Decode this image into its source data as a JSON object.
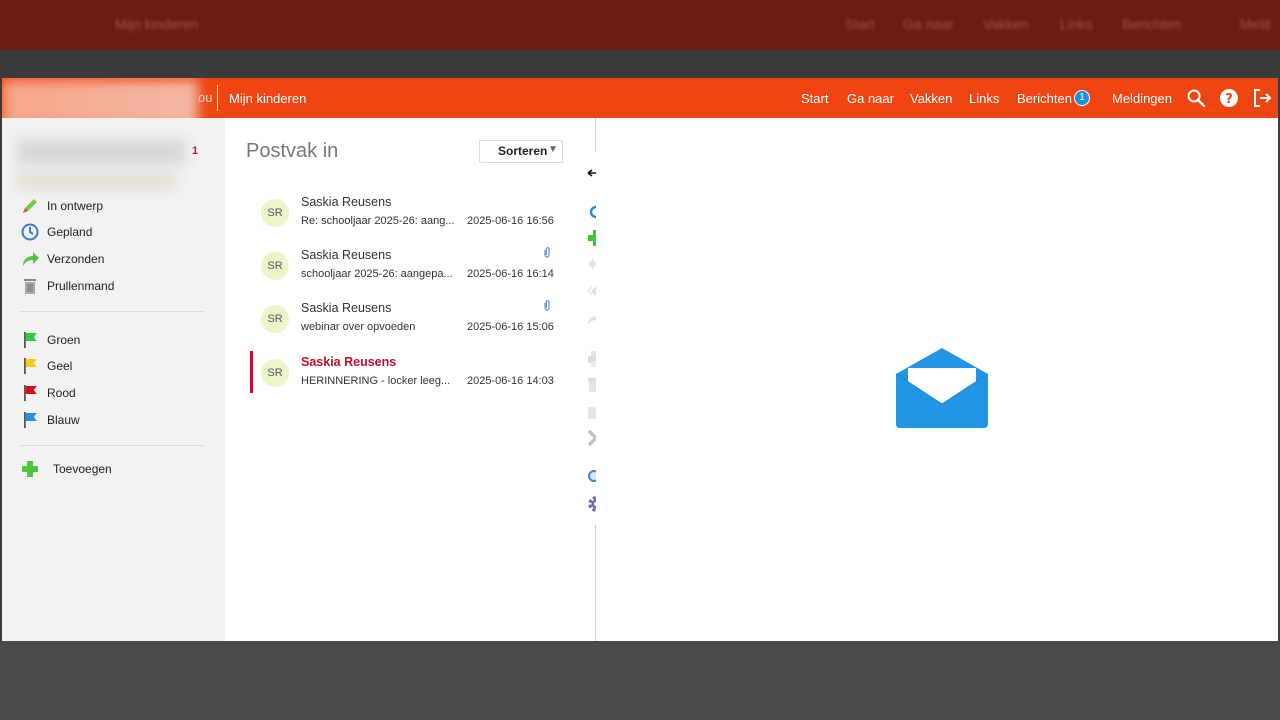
{
  "background": {
    "top_nav_blurred": [
      "Mijn kinderen",
      "Start",
      "Ga naar",
      "Vakken",
      "Links",
      "Berichten",
      "Meld"
    ]
  },
  "header": {
    "hidden_tail": "ou",
    "kids_link": "Mijn kinderen",
    "nav": [
      "Start",
      "Ga naar",
      "Vakken",
      "Links",
      "Berichten",
      "Meldingen"
    ],
    "messages_badge": "1",
    "icons": [
      "search-icon",
      "help-icon",
      "logout-icon"
    ]
  },
  "sidebar": {
    "inbox_count": "1",
    "folders": [
      {
        "label": "In ontwerp",
        "icon": "pencil-icon"
      },
      {
        "label": "Gepland",
        "icon": "clock-icon"
      },
      {
        "label": "Verzonden",
        "icon": "sent-arrow-icon"
      },
      {
        "label": "Prullenmand",
        "icon": "trash-icon"
      }
    ],
    "flags": [
      {
        "label": "Groen",
        "color": "#2ecc40"
      },
      {
        "label": "Geel",
        "color": "#f2d01a"
      },
      {
        "label": "Rood",
        "color": "#d0101a"
      },
      {
        "label": "Blauw",
        "color": "#2b8fe0"
      }
    ],
    "add_label": "Toevoegen"
  },
  "inbox": {
    "title": "Postvak in",
    "sort_label": "Sorteren",
    "messages": [
      {
        "initials": "SR",
        "from": "Saskia Reusens",
        "subject": "Re: schooljaar 2025-26: aang...",
        "date": "2025-06-16 16:56",
        "attachment": false,
        "unread": false
      },
      {
        "initials": "SR",
        "from": "Saskia Reusens",
        "subject": "schooljaar 2025-26: aangepa...",
        "date": "2025-06-16 16:14",
        "attachment": true,
        "unread": false
      },
      {
        "initials": "SR",
        "from": "Saskia Reusens",
        "subject": "webinar over opvoeden",
        "date": "2025-06-16 15:06",
        "attachment": true,
        "unread": false
      },
      {
        "initials": "SR",
        "from": "Saskia Reusens",
        "subject": "HERINNERING - locker leeg...",
        "date": "2025-06-16 14:03",
        "attachment": false,
        "unread": true
      }
    ]
  },
  "toolbar": [
    "resize-arrows-icon",
    "refresh-icon",
    "new-message-icon",
    "reply-icon",
    "reply-all-icon",
    "forward-icon",
    "print-icon",
    "archive-icon",
    "move-folder-icon",
    "delete-icon",
    "search-icon",
    "settings-icon"
  ],
  "colors": {
    "accent": "#ee4512",
    "unread": "#c0102d",
    "envelope": "#2196e6"
  }
}
